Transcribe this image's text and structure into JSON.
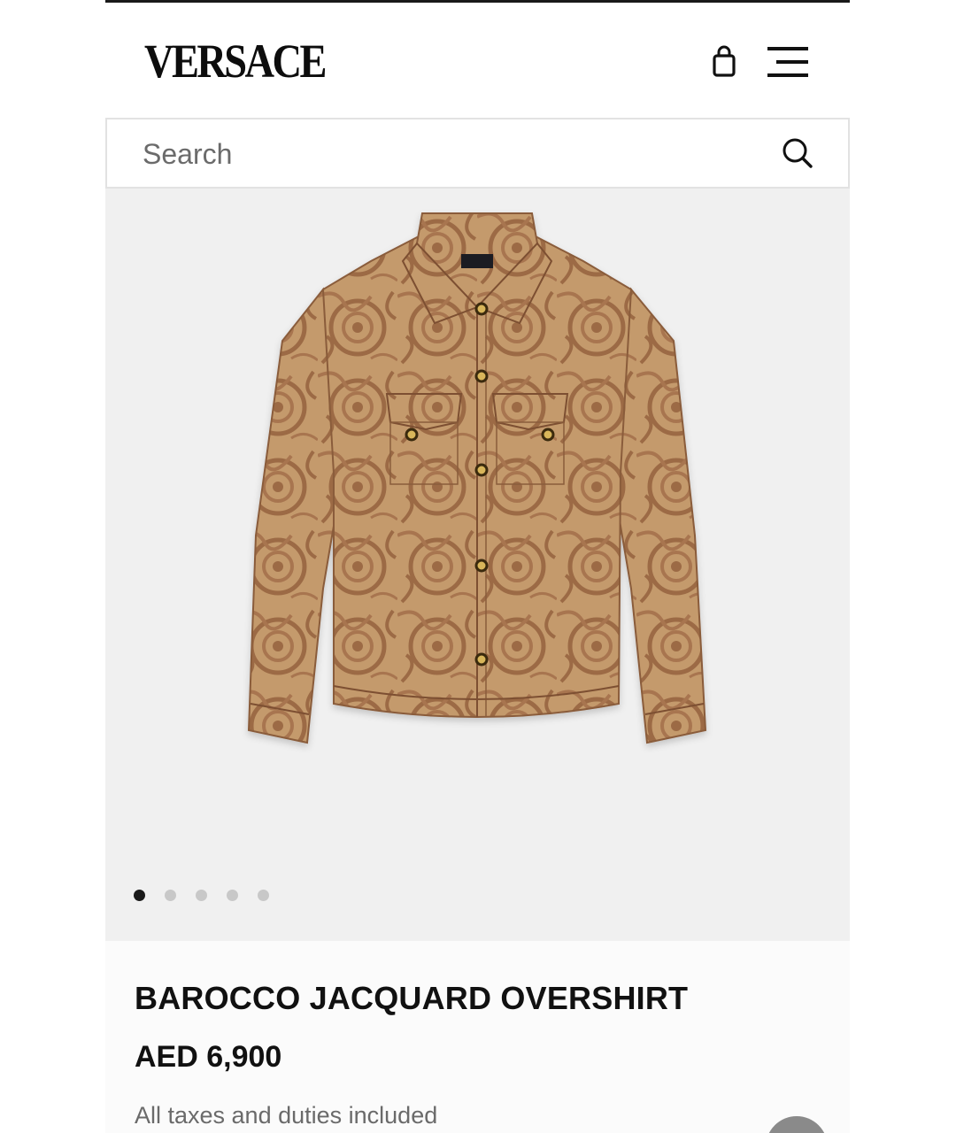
{
  "header": {
    "logo": "VERSACE",
    "icons": {
      "bag": "shopping-bag-icon",
      "menu": "hamburger-menu-icon"
    }
  },
  "search": {
    "placeholder": "Search",
    "value": "",
    "icon": "search-icon"
  },
  "gallery": {
    "image_alt": "Barocco jacquard overshirt",
    "slide_count": 5,
    "active_slide": 1
  },
  "product": {
    "title": "BAROCCO JACQUARD OVERSHIRT",
    "price": "AED 6,900",
    "tax_note": "All taxes and duties included"
  },
  "colors": {
    "gallery_bg": "#f0f0f0",
    "shirt_base": "#c49a6c",
    "shirt_pattern": "#9c6b45",
    "active_dot": "#1a1a1a",
    "inactive_dot": "#c8c8c8"
  }
}
